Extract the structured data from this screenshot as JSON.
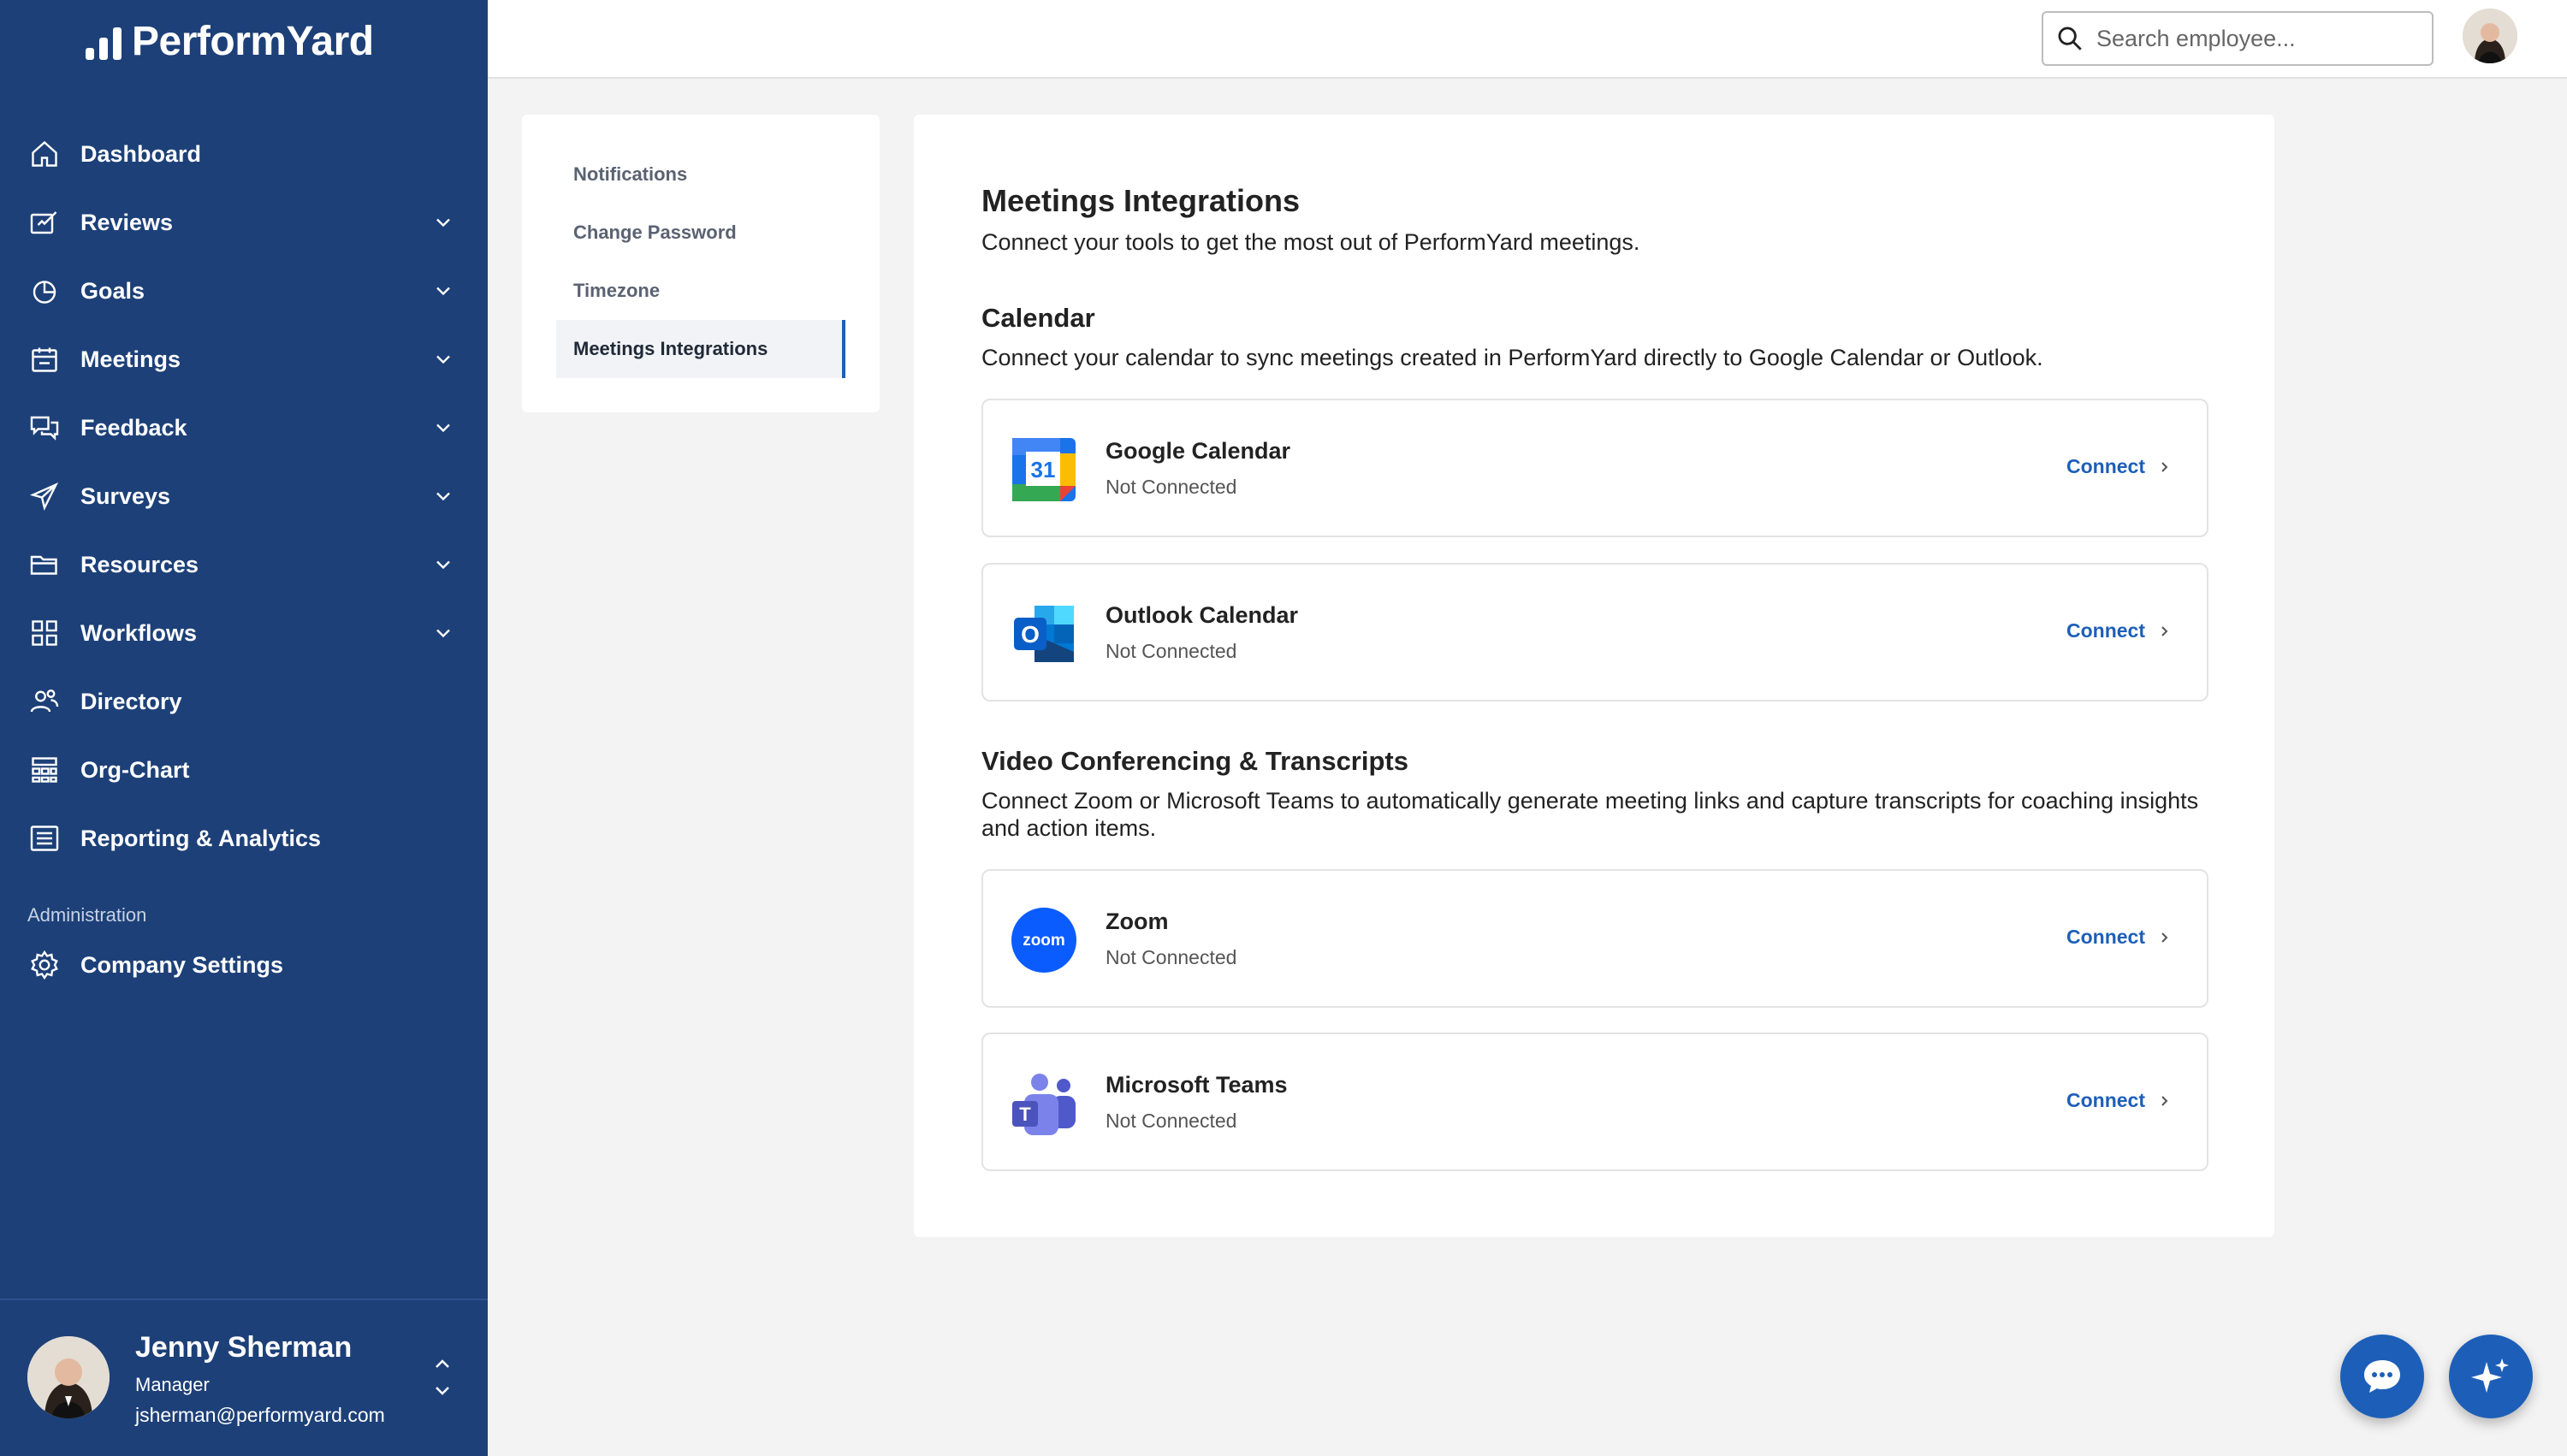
{
  "brand": {
    "name": "PerformYard"
  },
  "sidebar": {
    "items": [
      {
        "label": "Dashboard",
        "icon": "home-icon",
        "expandable": false
      },
      {
        "label": "Reviews",
        "icon": "reviews-icon",
        "expandable": true
      },
      {
        "label": "Goals",
        "icon": "goals-icon",
        "expandable": true
      },
      {
        "label": "Meetings",
        "icon": "calendar-icon",
        "expandable": true
      },
      {
        "label": "Feedback",
        "icon": "chat-icon",
        "expandable": true
      },
      {
        "label": "Surveys",
        "icon": "send-icon",
        "expandable": true
      },
      {
        "label": "Resources",
        "icon": "folder-icon",
        "expandable": true
      },
      {
        "label": "Workflows",
        "icon": "grid-icon",
        "expandable": true
      },
      {
        "label": "Directory",
        "icon": "people-icon",
        "expandable": false
      },
      {
        "label": "Org-Chart",
        "icon": "org-chart-icon",
        "expandable": false
      },
      {
        "label": "Reporting & Analytics",
        "icon": "list-icon",
        "expandable": false
      }
    ],
    "admin_heading": "Administration",
    "admin_item": {
      "label": "Company Settings",
      "icon": "gear-icon"
    },
    "user": {
      "name": "Jenny Sherman",
      "role": "Manager",
      "email": "jsherman@performyard.com"
    }
  },
  "topbar": {
    "search_placeholder": "Search employee..."
  },
  "settings_menu": {
    "items": [
      "Notifications",
      "Change Password",
      "Timezone",
      "Meetings Integrations"
    ],
    "active": "Meetings Integrations"
  },
  "main": {
    "title": "Meetings Integrations",
    "subtitle": "Connect your tools to get the most out of PerformYard meetings.",
    "calendar": {
      "heading": "Calendar",
      "description": "Connect your calendar to sync meetings created in PerformYard directly to Google Calendar or Outlook.",
      "integrations": [
        {
          "name": "Google Calendar",
          "status": "Not Connected",
          "action": "Connect",
          "logo_text": "31"
        },
        {
          "name": "Outlook Calendar",
          "status": "Not Connected",
          "action": "Connect",
          "logo_text": "O"
        }
      ]
    },
    "video": {
      "heading": "Video Conferencing & Transcripts",
      "description": "Connect Zoom or Microsoft Teams to automatically generate meeting links and capture transcripts for coaching insights and action items.",
      "integrations": [
        {
          "name": "Zoom",
          "status": "Not Connected",
          "action": "Connect",
          "logo_text": "zoom"
        },
        {
          "name": "Microsoft Teams",
          "status": "Not Connected",
          "action": "Connect",
          "logo_text": "T"
        }
      ]
    }
  },
  "colors": {
    "sidebar": "#1d4078",
    "accent": "#1d5fb8",
    "background": "#f3f3f3"
  }
}
